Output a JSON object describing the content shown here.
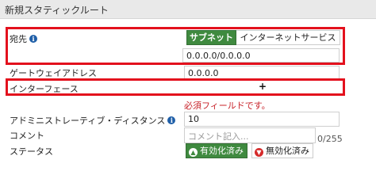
{
  "header": {
    "title": "新規スタティックルート"
  },
  "destination": {
    "label": "宛先",
    "info_icon": "info-icon",
    "tabs": [
      {
        "label": "サブネット",
        "selected": true
      },
      {
        "label": "インターネットサービス",
        "selected": false
      }
    ],
    "value": "0.0.0.0/0.0.0.0"
  },
  "gateway": {
    "label": "ゲートウェイアドレス",
    "value": "0.0.0.0"
  },
  "interface": {
    "label": "インターフェース",
    "add_icon": "plus-icon",
    "add_symbol": "+",
    "error": "必須フィールドです。"
  },
  "admin_distance": {
    "label": "アドミニストレーティブ・ディスタンス",
    "info_icon": "info-icon",
    "value": "10"
  },
  "comment": {
    "label": "コメント",
    "placeholder": "コメント記入...",
    "counter": "0/255"
  },
  "status": {
    "label": "ステータス",
    "enabled": {
      "label": "有効化済み",
      "icon": "arrow-up-circle-icon",
      "symbol": "▲",
      "selected": true
    },
    "disabled": {
      "label": "無効化済み",
      "icon": "arrow-down-circle-icon",
      "symbol": "▼",
      "selected": false
    }
  },
  "colors": {
    "highlight": "#e3111d",
    "active_green": "#3f8a3f",
    "error_red": "#c8232a",
    "info_blue": "#1f5fa8"
  }
}
